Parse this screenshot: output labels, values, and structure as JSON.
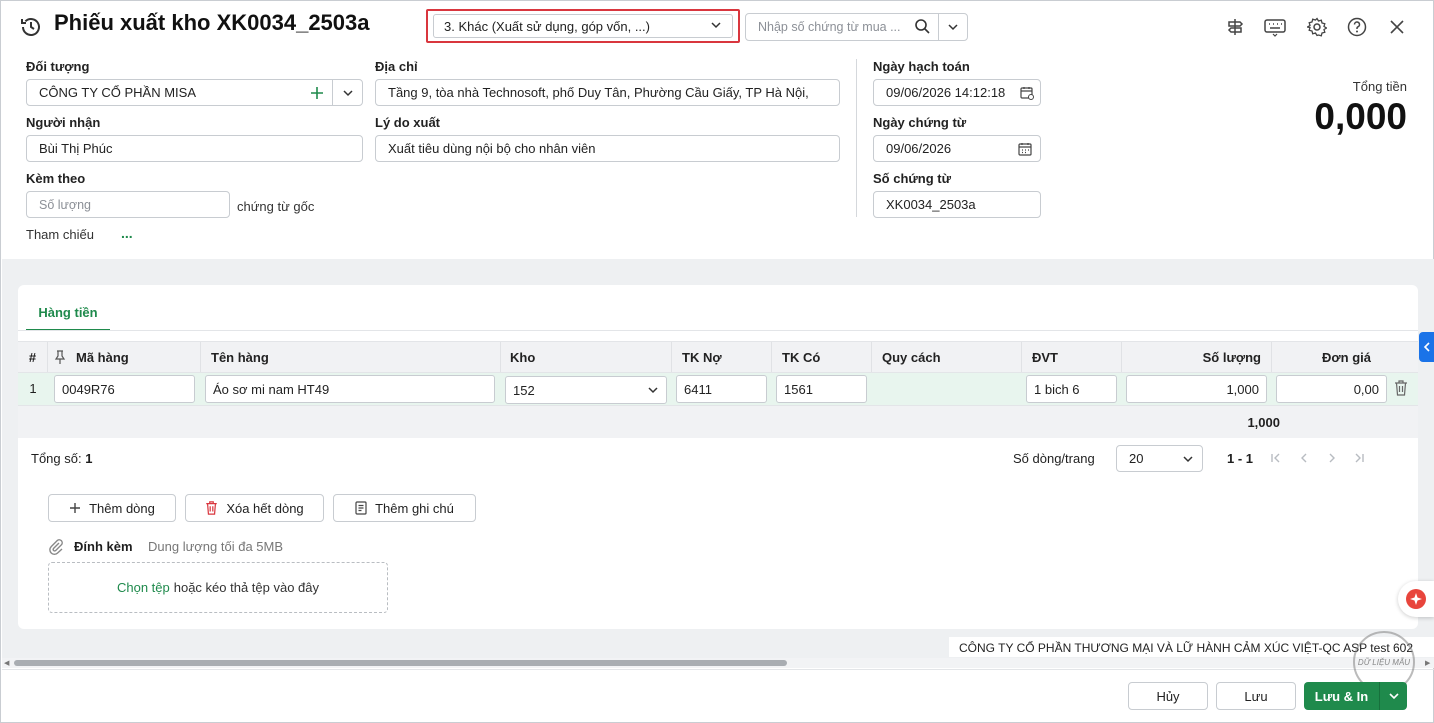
{
  "header": {
    "title": "Phiếu xuất kho XK0034_2503a",
    "type_select": "3. Khác (Xuất sử dụng, góp vốn, ...)",
    "search_placeholder": "Nhập số chứng từ mua ..."
  },
  "form": {
    "doi_tuong_label": "Đối tượng",
    "doi_tuong_value": "CÔNG TY CỔ PHẦN MISA",
    "dia_chi_label": "Địa chỉ",
    "dia_chi_value": "Tầng 9, tòa nhà Technosoft, phố Duy Tân, Phường Cầu Giấy, TP Hà Nội,",
    "nguoi_nhan_label": "Người nhận",
    "nguoi_nhan_value": "Bùi Thị Phúc",
    "ly_do_label": "Lý do xuất",
    "ly_do_value": "Xuất tiêu dùng nội bộ cho nhân viên",
    "kem_theo_label": "Kèm theo",
    "so_luong_placeholder": "Số lượng",
    "chung_tu_goc": "chứng từ gốc",
    "tham_chieu_label": "Tham chiếu",
    "tham_chieu_more": "...",
    "ngay_hach_toan_label": "Ngày hạch toán",
    "ngay_hach_toan_value": "09/06/2026 14:12:18",
    "ngay_chung_tu_label": "Ngày chứng từ",
    "ngay_chung_tu_value": "09/06/2026",
    "so_chung_tu_label": "Số chứng từ",
    "so_chung_tu_value": "XK0034_2503a",
    "tong_tien_label": "Tổng tiền",
    "tong_tien_value": "0,000"
  },
  "tabs": [
    {
      "label": "Hàng tiền"
    }
  ],
  "table": {
    "columns": [
      "#",
      "Mã hàng",
      "Tên hàng",
      "Kho",
      "TK Nợ",
      "TK Có",
      "Quy cách",
      "ĐVT",
      "Số lượng",
      "Đơn giá"
    ],
    "rows": [
      {
        "no": "1",
        "ma_hang": "0049R76",
        "ten_hang": "Áo sơ mi nam HT49",
        "kho": "152",
        "tk_no": "6411",
        "tk_co": "1561",
        "quy_cach": "",
        "dvt": "1 bich 6",
        "so_luong": "1,000",
        "don_gia": "0,00"
      }
    ],
    "sum_so_luong": "1,000"
  },
  "pager": {
    "tong_so_label": "Tổng số:",
    "tong_so_value": "1",
    "rows_per_page_label": "Số dòng/trang",
    "rows_per_page_value": "20",
    "range": "1 - 1"
  },
  "actions": {
    "them_dong": "Thêm dòng",
    "xoa_het_dong": "Xóa hết dòng",
    "them_ghi_chu": "Thêm ghi chú"
  },
  "attach": {
    "label": "Đính kèm",
    "hint": "Dung lượng tối đa 5MB",
    "choose_link": "Chọn tệp",
    "drop_text": "hoặc kéo thả tệp vào đây"
  },
  "footer": {
    "company": "CÔNG TY CỔ PHẦN THƯƠNG MẠI VÀ LỮ HÀNH CẢM XÚC VIỆT-QC ASP test 602",
    "stamp": "DỮ LIỆU MẪU",
    "huy": "Hủy",
    "luu": "Lưu",
    "luu_in": "Lưu & In"
  },
  "colors": {
    "accent_green": "#1f8a4c",
    "highlight_red": "#d9363e",
    "side_blue": "#1a73e8"
  }
}
